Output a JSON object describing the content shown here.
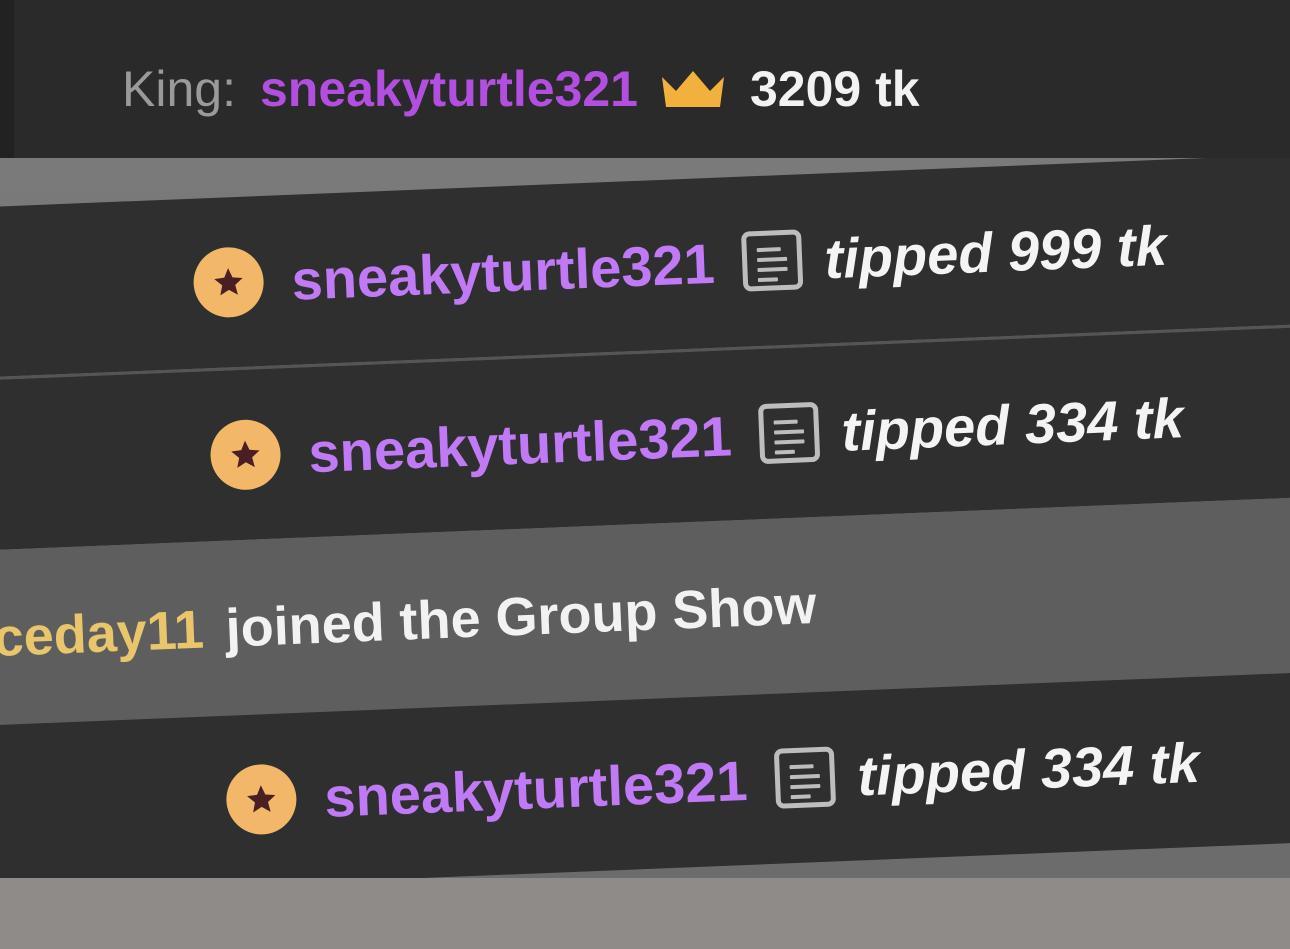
{
  "header": {
    "king_label": "King:",
    "king_username": "sneakyturtle321",
    "king_amount": "3209 tk",
    "crown_icon": "crown-icon",
    "colors": {
      "label": "#9a9a9a",
      "username": "#b24fe0",
      "crown": "#f2b13d",
      "amount": "#f2f2f2"
    }
  },
  "chat": {
    "messages": [
      {
        "type": "tip",
        "username": "sneakyturtle321",
        "text": "tipped 999 tk",
        "badge_icon": "star-badge-icon",
        "note_icon": "note-icon"
      },
      {
        "type": "tip",
        "username": "sneakyturtle321",
        "text": "tipped 334 tk",
        "badge_icon": "star-badge-icon",
        "note_icon": "note-icon"
      },
      {
        "type": "system",
        "username": "ceday11",
        "text": "joined the Group Show"
      },
      {
        "type": "tip",
        "username": "sneakyturtle321",
        "text": "tipped 334 tk",
        "badge_icon": "star-badge-icon",
        "note_icon": "note-icon"
      }
    ],
    "colors": {
      "tip_username": "#c07af5",
      "system_username": "#e9c66b",
      "badge": "#f2b769"
    }
  }
}
